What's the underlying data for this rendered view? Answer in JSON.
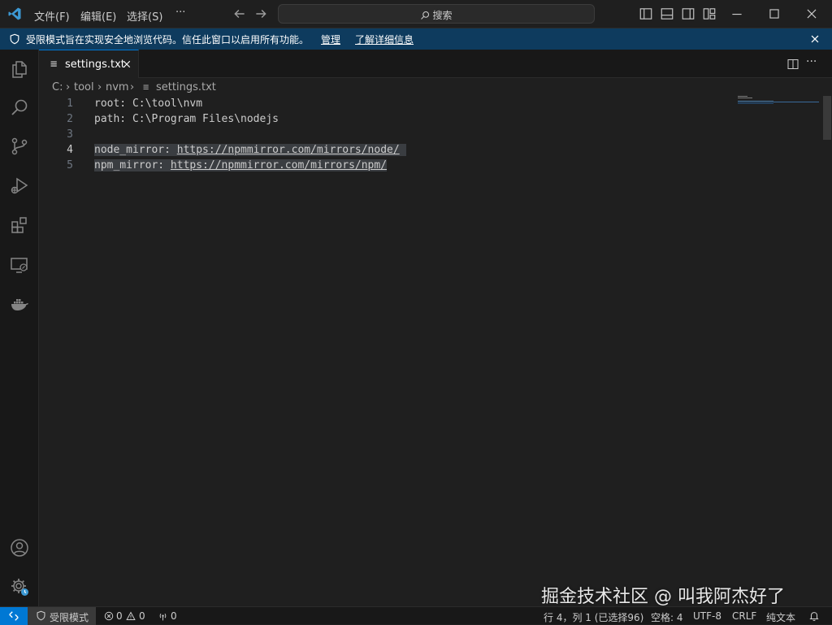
{
  "colors": {
    "accent": "#0078d4",
    "banner_bg": "#0e3b5e",
    "editor_bg": "#1f1f1f",
    "selection": "#3a3d41"
  },
  "titlebar": {
    "menu": [
      "文件(F)",
      "编辑(E)",
      "选择(S)",
      "···"
    ],
    "search_placeholder": "搜索",
    "icons": [
      "vscode-logo-icon",
      "back-arrow-icon",
      "forward-arrow-icon",
      "toggle-primary-sidebar-icon",
      "toggle-panel-icon",
      "toggle-secondary-sidebar-icon",
      "customize-layout-icon",
      "minimize-icon",
      "maximize-icon",
      "close-icon"
    ]
  },
  "banner": {
    "message": "受限模式旨在实现安全地浏览代码。信任此窗口以启用所有功能。",
    "manage_link": "管理",
    "learn_more_link": "了解详细信息"
  },
  "activitybar": {
    "items": [
      "explorer-icon",
      "search-icon",
      "source-control-icon",
      "run-debug-icon",
      "extensions-icon",
      "remote-explorer-icon",
      "docker-icon"
    ],
    "bottom": [
      "account-icon",
      "manage-gear-icon"
    ]
  },
  "tab": {
    "label": "settings.txt",
    "icon": "text-file-icon"
  },
  "breadcrumb": {
    "parts": [
      "C:",
      "tool",
      "nvm",
      "settings.txt"
    ]
  },
  "editor": {
    "lines": [
      {
        "num": "1",
        "text": "root: C:\\tool\\nvm"
      },
      {
        "num": "2",
        "text": "path: C:\\Program Files\\nodejs"
      },
      {
        "num": "3",
        "text": ""
      },
      {
        "num": "4",
        "key": "node_mirror: ",
        "url": "https://npmmirror.com/mirrors/node/"
      },
      {
        "num": "5",
        "key": "npm_mirror: ",
        "url": "https://npmmirror.com/mirrors/npm/"
      }
    ],
    "active_line": "4"
  },
  "statusbar": {
    "restricted_mode": "受限模式",
    "errors": "0",
    "warnings": "0",
    "ports": "0",
    "position": "行 4，列 1 (已选择96)",
    "spaces": "空格: 4",
    "encoding": "UTF-8",
    "eol": "CRLF",
    "language": "纯文本"
  },
  "watermark": "掘金技术社区 @ 叫我阿杰好了"
}
